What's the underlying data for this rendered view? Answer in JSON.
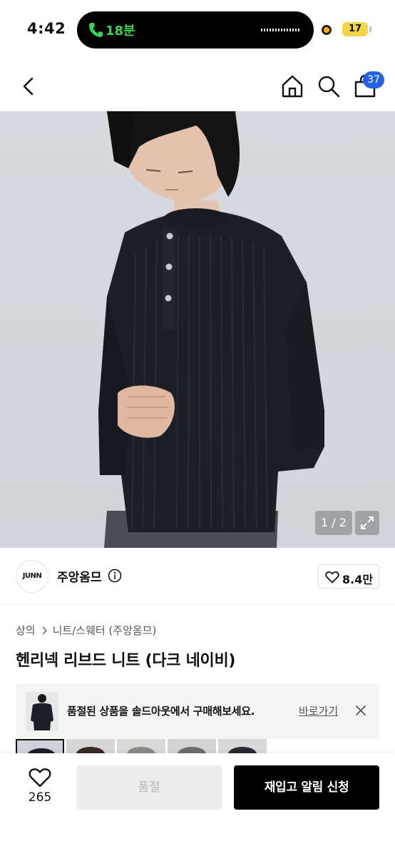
{
  "status_bar": {
    "time": "4:42",
    "call_duration": "18분",
    "battery": "17",
    "colors": {
      "call_green": "#39d353",
      "battery": "#f0d548",
      "privacy_dot": "#ffb000"
    }
  },
  "header": {
    "icons": [
      "chevron-left-icon",
      "home-icon",
      "search-icon",
      "shopping-bag-icon"
    ],
    "cart_count": "37",
    "badge_color": "#2462e5"
  },
  "gallery": {
    "page_indicator": "1 / 2",
    "icons": [
      "expand-icon"
    ]
  },
  "brand": {
    "logo_text": "JUNN",
    "name": "주앙옴므",
    "like_count": "8.4만"
  },
  "product": {
    "breadcrumb": [
      "상의",
      "니트/스웨터 (주앙옴므)"
    ],
    "title": "헨리넥 리브드 니트 (다크 네이비)"
  },
  "soldout_banner": {
    "message": "품절된 상품을 솔드아웃에서 구매해보세요.",
    "link_label": "바로가기",
    "icons": [
      "close-icon"
    ]
  },
  "bottom_bar": {
    "wish_count": "265",
    "soldout_label": "품절",
    "restock_label": "재입고 알림 신청"
  }
}
